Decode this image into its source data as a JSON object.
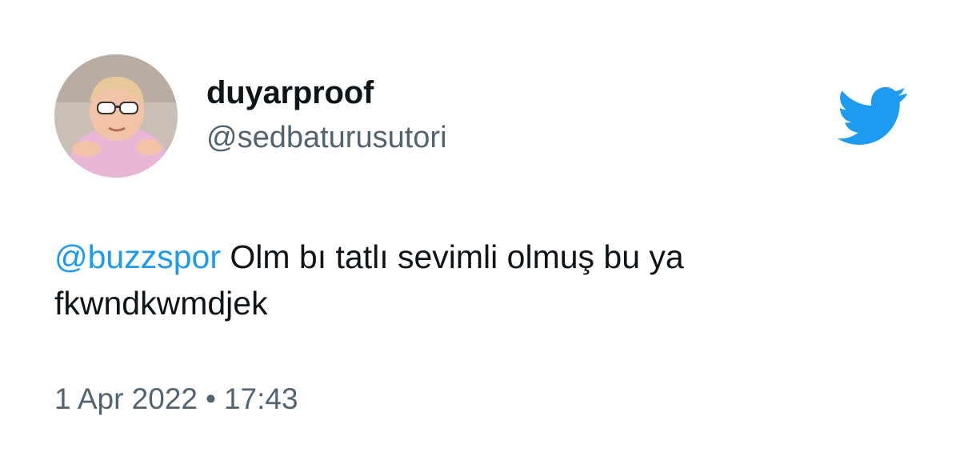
{
  "user": {
    "display_name": "duyarproof",
    "handle": "@sedbaturusutori",
    "avatar_icon": "profile-photo"
  },
  "tweet": {
    "mention": "@buzzspor",
    "text": " Olm bı tatlı sevimli olmuş bu ya fkwndkwmdjek"
  },
  "meta": {
    "date": "1 Apr 2022",
    "separator": "•",
    "time": "17:43"
  },
  "icons": {
    "brand": "twitter-bird-icon"
  },
  "colors": {
    "brand_blue": "#1d9bf0",
    "text": "#0f1419",
    "secondary_text": "#536471",
    "background": "#ffffff"
  }
}
